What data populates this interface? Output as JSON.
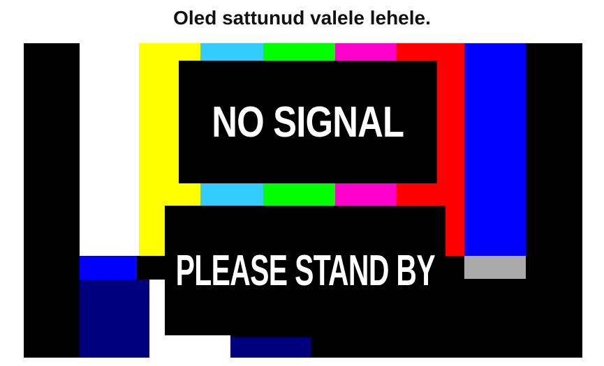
{
  "page": {
    "heading": "Oled sattunud valele lehele."
  },
  "test_pattern": {
    "line1": "NO SIGNAL",
    "line2": "PLEASE STAND BY",
    "colors": {
      "white": "#ffffff",
      "yellow": "#ffff00",
      "cyan": "#33ccff",
      "green": "#00ff00",
      "magenta": "#ff00cc",
      "red": "#ff0000",
      "blue": "#0000ff",
      "gray": "#aaaaaa",
      "navy": "#00007f",
      "black": "#000000"
    }
  }
}
